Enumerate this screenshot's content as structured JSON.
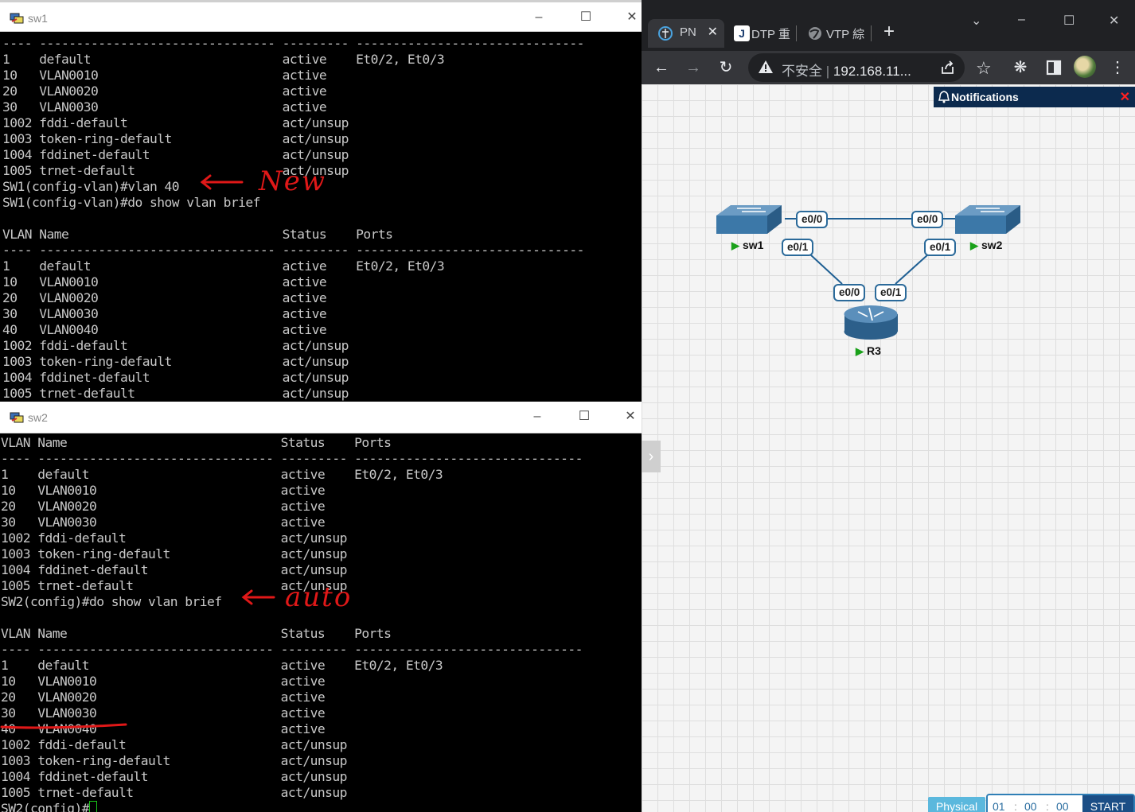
{
  "sw1_window": {
    "title": "sw1",
    "lines": [
      "---- -------------------------------- --------- -------------------------------",
      "1    default                          active    Et0/2, Et0/3",
      "10   VLAN0010                         active",
      "20   VLAN0020                         active",
      "30   VLAN0030                         active",
      "1002 fddi-default                     act/unsup",
      "1003 token-ring-default               act/unsup",
      "1004 fddinet-default                  act/unsup",
      "1005 trnet-default                    act/unsup",
      "SW1(config-vlan)#vlan 40",
      "SW1(config-vlan)#do show vlan brief",
      "",
      "VLAN Name                             Status    Ports",
      "---- -------------------------------- --------- -------------------------------",
      "1    default                          active    Et0/2, Et0/3",
      "10   VLAN0010                         active",
      "20   VLAN0020                         active",
      "30   VLAN0030                         active",
      "40   VLAN0040                         active",
      "1002 fddi-default                     act/unsup",
      "1003 token-ring-default               act/unsup",
      "1004 fddinet-default                  act/unsup",
      "1005 trnet-default                    act/unsup"
    ],
    "annotation": "New"
  },
  "sw2_window": {
    "title": "sw2",
    "lines": [
      "VLAN Name                             Status    Ports",
      "---- -------------------------------- --------- -------------------------------",
      "1    default                          active    Et0/2, Et0/3",
      "10   VLAN0010                         active",
      "20   VLAN0020                         active",
      "30   VLAN0030                         active",
      "1002 fddi-default                     act/unsup",
      "1003 token-ring-default               act/unsup",
      "1004 fddinet-default                  act/unsup",
      "1005 trnet-default                    act/unsup",
      "SW2(config)#do show vlan brief",
      "",
      "VLAN Name                             Status    Ports",
      "---- -------------------------------- --------- -------------------------------",
      "1    default                          active    Et0/2, Et0/3",
      "10   VLAN0010                         active",
      "20   VLAN0020                         active",
      "30   VLAN0030                         active",
      "40   VLAN0040                         active",
      "1002 fddi-default                     act/unsup",
      "1003 token-ring-default               act/unsup",
      "1004 fddinet-default                  act/unsup",
      "1005 trnet-default                    act/unsup"
    ],
    "prompt": "SW2(config)#",
    "annotation": "auto"
  },
  "browser": {
    "tabs": [
      {
        "label": "PN",
        "icon": "pnetlab-icon"
      },
      {
        "label": "DTP 重",
        "icon": "j-icon"
      },
      {
        "label": "VTP 綜",
        "icon": "globe-icon"
      }
    ],
    "omnibox": {
      "security": "不安全",
      "url": "192.168.11..."
    },
    "notifications_label": "Notifications",
    "footer": {
      "physical": "Physical",
      "hours": "01",
      "minutes": "00",
      "seconds": "00",
      "start": "START"
    }
  },
  "topology": {
    "nodes": [
      {
        "name": "sw1",
        "type": "switch"
      },
      {
        "name": "sw2",
        "type": "switch"
      },
      {
        "name": "R3",
        "type": "router"
      }
    ],
    "links": [
      {
        "a": "sw1 e0/0",
        "b": "sw2 e0/0"
      },
      {
        "a": "sw1 e0/1",
        "b": "R3 e0/0"
      },
      {
        "a": "sw2 e0/1",
        "b": "R3 e0/1"
      }
    ],
    "labels": {
      "sw1_e00": "e0/0",
      "sw2_e00": "e0/0",
      "sw1_e01": "e0/1",
      "sw2_e01": "e0/1",
      "r3_e00": "e0/0",
      "r3_e01": "e0/1"
    }
  }
}
